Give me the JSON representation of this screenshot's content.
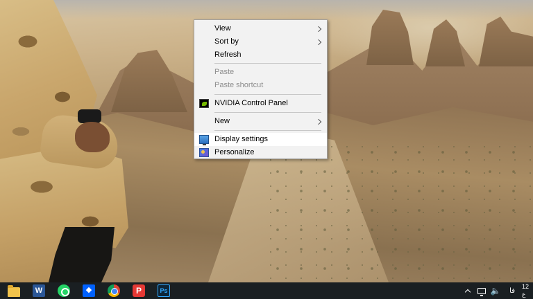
{
  "context_menu": {
    "items": [
      {
        "label": "View",
        "has_submenu": true,
        "enabled": true
      },
      {
        "label": "Sort by",
        "has_submenu": true,
        "enabled": true
      },
      {
        "label": "Refresh",
        "has_submenu": false,
        "enabled": true
      },
      {
        "label": "Paste",
        "has_submenu": false,
        "enabled": false
      },
      {
        "label": "Paste shortcut",
        "has_submenu": false,
        "enabled": false
      },
      {
        "label": "NVIDIA Control Panel",
        "has_submenu": false,
        "enabled": true,
        "icon": "nvidia-icon"
      },
      {
        "label": "New",
        "has_submenu": true,
        "enabled": true
      },
      {
        "label": "Display settings",
        "has_submenu": false,
        "enabled": true,
        "icon": "display-icon",
        "highlighted": true
      },
      {
        "label": "Personalize",
        "has_submenu": false,
        "enabled": true,
        "icon": "personalize-icon"
      }
    ]
  },
  "taskbar": {
    "apps": [
      {
        "name": "File Explorer",
        "icon": "file-explorer-icon"
      },
      {
        "name": "Microsoft Word",
        "icon": "word-icon",
        "glyph": "W"
      },
      {
        "name": "WhatsApp",
        "icon": "whatsapp-icon"
      },
      {
        "name": "Dropbox",
        "icon": "dropbox-icon"
      },
      {
        "name": "Google Chrome",
        "icon": "chrome-icon"
      },
      {
        "name": "Psiphon",
        "icon": "psiphon-icon",
        "glyph": "P"
      },
      {
        "name": "Adobe Photoshop",
        "icon": "photoshop-icon",
        "glyph": "Ps"
      }
    ],
    "tray": {
      "language": "فا",
      "clock_time": "12",
      "clock_suffix": "ع"
    }
  },
  "colors": {
    "taskbar_bg": "#1a1f22",
    "menu_bg": "#f2f2f2",
    "menu_highlight": "#ffffff",
    "disabled_text": "#8d8d8d"
  }
}
